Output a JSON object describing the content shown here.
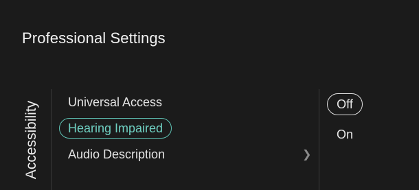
{
  "header": {
    "title": "Professional Settings"
  },
  "category": {
    "label": "Accessibility"
  },
  "menu": {
    "items": [
      {
        "label": "Universal Access"
      },
      {
        "label": "Hearing Impaired"
      },
      {
        "label": "Audio Description"
      }
    ],
    "chevron_icon": "chevron-right-icon"
  },
  "options": {
    "items": [
      {
        "label": "Off"
      },
      {
        "label": "On"
      }
    ]
  },
  "colors": {
    "background": "#1b1b1b",
    "accent": "#5fc3b5",
    "text": "#e8e8e8"
  }
}
